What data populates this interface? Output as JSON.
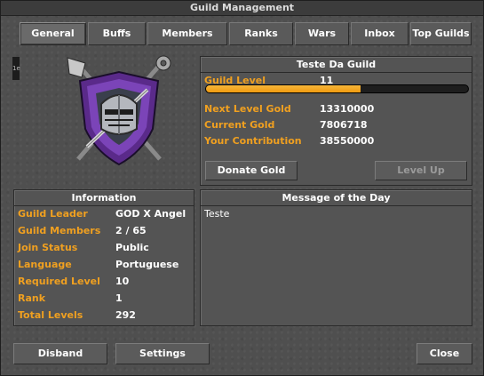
{
  "window": {
    "title": "Guild Management"
  },
  "tabs": [
    {
      "label": "General",
      "active": true
    },
    {
      "label": "Buffs",
      "active": false
    },
    {
      "label": "Members",
      "active": false
    },
    {
      "label": "Ranks",
      "active": false
    },
    {
      "label": "Wars",
      "active": false
    },
    {
      "label": "Inbox",
      "active": false
    },
    {
      "label": "Top Guilds",
      "active": false
    }
  ],
  "sidebar_mark": "1e",
  "guild_panel": {
    "name": "Teste Da Guild",
    "level_label": "Guild Level",
    "level_value": "11",
    "progress_fraction": 0.59,
    "next_level_gold_label": "Next Level Gold",
    "next_level_gold_value": "13310000",
    "current_gold_label": "Current Gold",
    "current_gold_value": "7806718",
    "contribution_label": "Your Contribution",
    "contribution_value": "38550000",
    "donate_button": "Donate Gold",
    "levelup_button": "Level Up"
  },
  "information": {
    "title": "Information",
    "rows": [
      {
        "label": "Guild Leader",
        "value": "GOD X Angel"
      },
      {
        "label": "Guild Members",
        "value": "2 / 65"
      },
      {
        "label": "Join Status",
        "value": "Public"
      },
      {
        "label": "Language",
        "value": "Portuguese"
      },
      {
        "label": "Required Level",
        "value": "10"
      },
      {
        "label": "Rank",
        "value": "1"
      },
      {
        "label": "Total Levels",
        "value": "292"
      }
    ]
  },
  "motd": {
    "title": "Message of the Day",
    "text": "Teste"
  },
  "footer": {
    "disband": "Disband",
    "settings": "Settings",
    "close": "Close"
  },
  "colors": {
    "label": "#f0a020",
    "value": "#ffffff",
    "progress": "#f5a623"
  },
  "icons": {
    "emblem": "guild-shield-emblem-icon"
  }
}
